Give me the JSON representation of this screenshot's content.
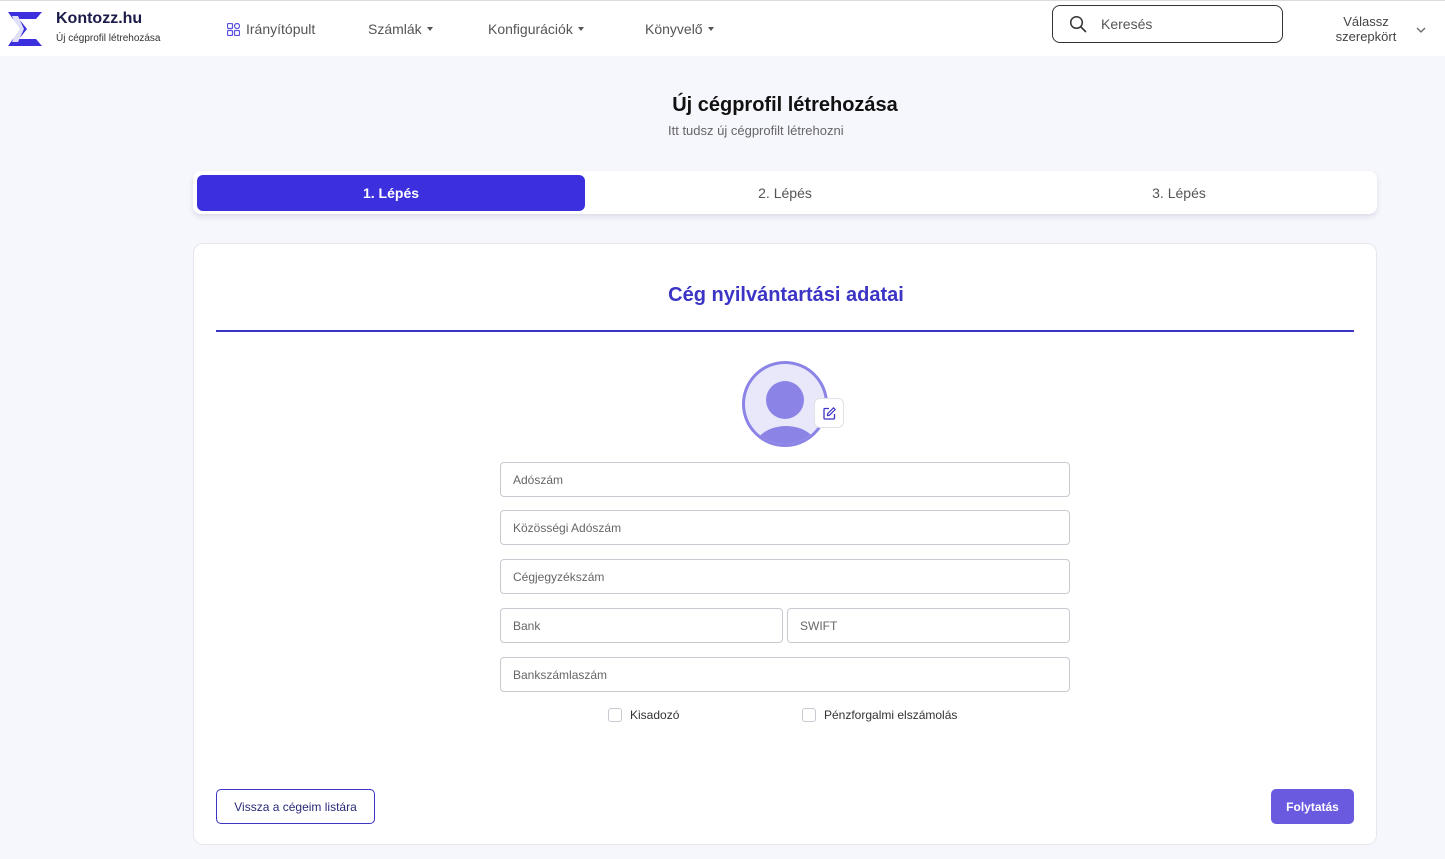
{
  "brand": {
    "name": "Kontozz.hu",
    "subtitle": "Új cégprofil létrehozása",
    "logo_icon": "kontozz-logo-icon"
  },
  "nav": {
    "items": [
      {
        "label": "Irányítópult",
        "icon": "dashboard-grid-icon",
        "has_caret": false
      },
      {
        "label": "Számlák",
        "has_caret": true
      },
      {
        "label": "Konfigurációk",
        "has_caret": true
      },
      {
        "label": "Könyvelő",
        "has_caret": true
      }
    ],
    "search": {
      "placeholder": "Keresés",
      "value": ""
    },
    "role_select": {
      "line1": "Válassz",
      "line2": "szerepkört"
    }
  },
  "page": {
    "title": "Új cégprofil létrehozása",
    "subtitle": "Itt tudsz új cégprofilt létrehozni"
  },
  "stepper": {
    "steps": [
      "1. Lépés",
      "2. Lépés",
      "3. Lépés"
    ],
    "active_index": 0
  },
  "form": {
    "section_title": "Cég nyilvántartási adatai",
    "fields": {
      "tax_number": {
        "placeholder": "Adószám",
        "value": ""
      },
      "eu_tax_number": {
        "placeholder": "Közösségi Adószám",
        "value": ""
      },
      "company_reg_number": {
        "placeholder": "Cégjegyzékszám",
        "value": ""
      },
      "bank": {
        "placeholder": "Bank",
        "value": ""
      },
      "swift": {
        "placeholder": "SWIFT",
        "value": ""
      },
      "bank_account": {
        "placeholder": "Bankszámlaszám",
        "value": ""
      }
    },
    "checkboxes": {
      "small_taxpayer": {
        "label": "Kisadozó",
        "checked": false
      },
      "cash_accounting": {
        "label": "Pénzforgalmi elszámolás",
        "checked": false
      }
    },
    "back_button": "Vissza a cégeim listára",
    "next_button": "Folytatás"
  },
  "colors": {
    "accent": "#3b2fde",
    "section_title": "#3b34c4",
    "primary_button": "#6a5ae0",
    "avatar": "#8b84e6",
    "background": "#f6f7fd"
  }
}
